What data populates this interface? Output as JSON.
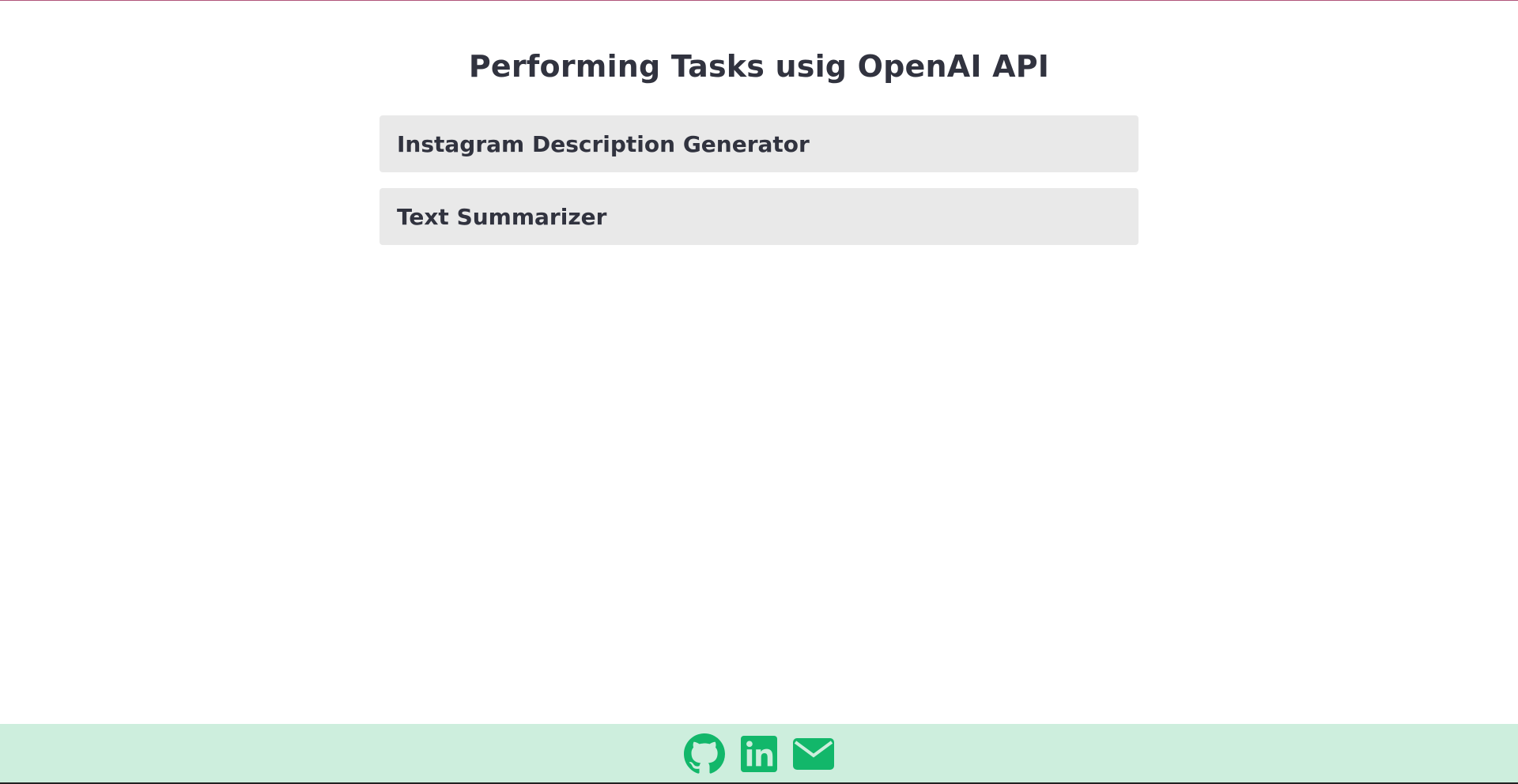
{
  "page": {
    "title": "Performing Tasks usig OpenAI API"
  },
  "tasks": [
    {
      "label": "Instagram Description Generator"
    },
    {
      "label": "Text Summarizer"
    }
  ],
  "footer": {
    "icons": [
      "github-icon",
      "linkedin-icon",
      "email-icon"
    ],
    "icon_color": "#12b76a",
    "background": "#cdeedd"
  },
  "colors": {
    "card_background": "#e9e9e9",
    "text": "#31333f",
    "top_accent": "#b0557a"
  }
}
